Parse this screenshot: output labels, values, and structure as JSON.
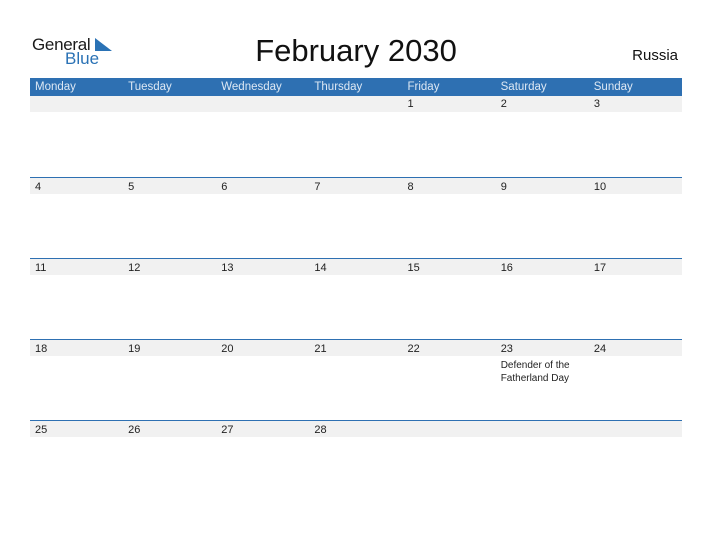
{
  "logo": {
    "general": "General",
    "blue": "Blue"
  },
  "title": "February 2030",
  "country": "Russia",
  "weekdays": [
    "Monday",
    "Tuesday",
    "Wednesday",
    "Thursday",
    "Friday",
    "Saturday",
    "Sunday"
  ],
  "weeks": [
    [
      "",
      "",
      "",
      "",
      "1",
      "2",
      "3"
    ],
    [
      "4",
      "5",
      "6",
      "7",
      "8",
      "9",
      "10"
    ],
    [
      "11",
      "12",
      "13",
      "14",
      "15",
      "16",
      "17"
    ],
    [
      "18",
      "19",
      "20",
      "21",
      "22",
      "23",
      "24"
    ],
    [
      "25",
      "26",
      "27",
      "28",
      "",
      "",
      ""
    ]
  ],
  "holidays": [
    {
      "week": 3,
      "day": 5,
      "name": "Defender of the Fatherland Day"
    }
  ],
  "colors": {
    "accent": "#2e70b2",
    "strip": "#f1f1f1"
  }
}
